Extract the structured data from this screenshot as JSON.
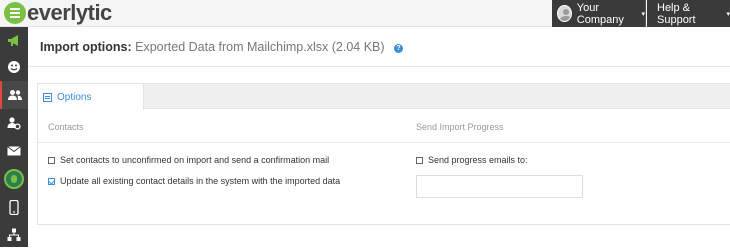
{
  "header": {
    "logo_text": "everlytic",
    "company_label": "Your Company",
    "help_label": "Help & Support",
    "caret": "▾"
  },
  "sidebar": {
    "items": [
      {
        "icon": "megaphone-icon"
      },
      {
        "icon": "smiley-icon"
      },
      {
        "icon": "contacts-icon",
        "active": true
      },
      {
        "icon": "user-settings-icon"
      },
      {
        "icon": "mail-icon"
      },
      {
        "icon": "lightbulb-icon"
      },
      {
        "icon": "mobile-icon"
      },
      {
        "icon": "sitemap-icon"
      }
    ]
  },
  "page": {
    "title": "Import options:",
    "subtitle": "Exported Data from Mailchimp.xlsx (2.04 KB)",
    "help_symbol": "?"
  },
  "tabs": [
    {
      "label": "Options",
      "active": true
    }
  ],
  "sections": {
    "contacts_heading": "Contacts",
    "progress_heading": "Send Import Progress"
  },
  "options": {
    "set_unconfirmed": {
      "label": "Set contacts to unconfirmed on import and send a confirmation mail",
      "checked": false
    },
    "update_existing": {
      "label": "Update all existing contact details in the system with the imported data",
      "checked": true
    },
    "send_progress": {
      "label": "Send progress emails to:",
      "checked": false
    }
  },
  "progress_email": {
    "value": "",
    "placeholder": ""
  },
  "colors": {
    "brand_green": "#7ac143",
    "accent_blue": "#3a8fd9",
    "topbar_dark": "#3a3a3a",
    "active_marker": "#e14a3b"
  }
}
